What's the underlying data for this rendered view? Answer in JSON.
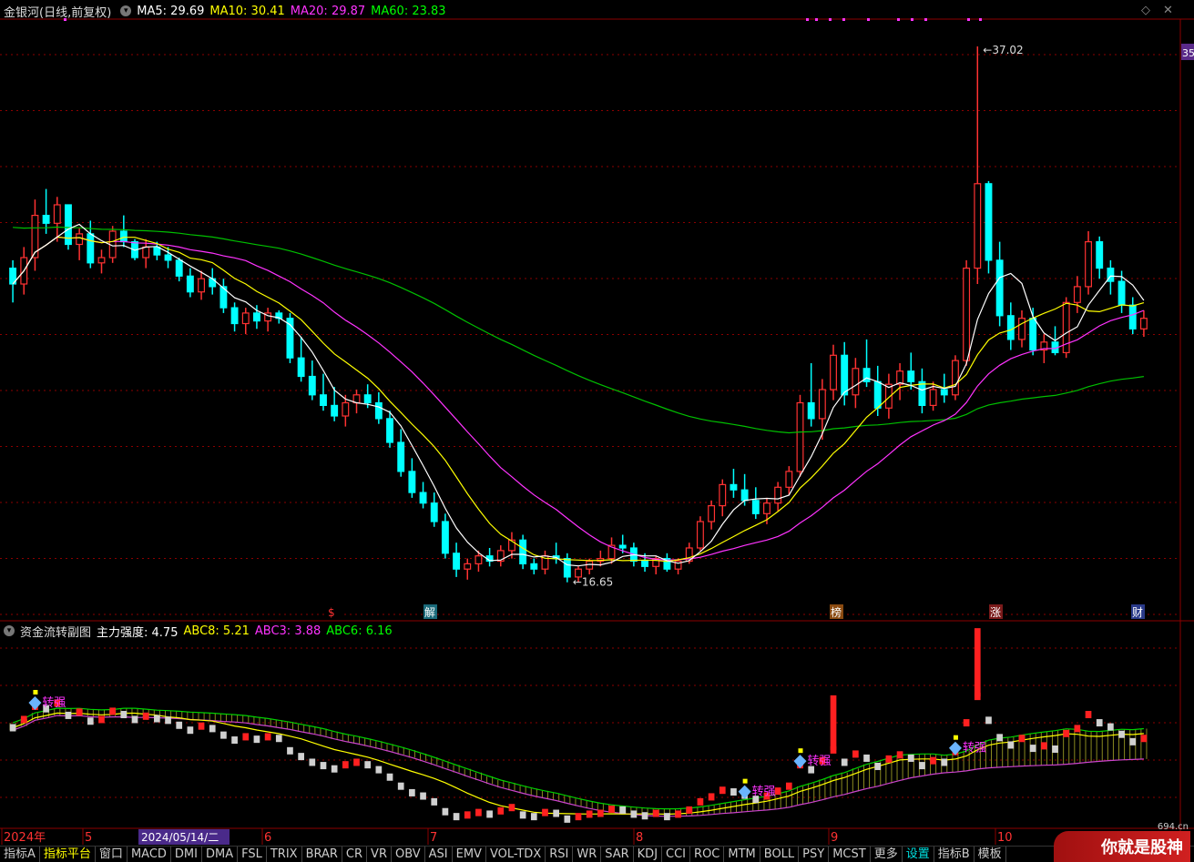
{
  "stock": {
    "title": "金银河(日线,前复权)"
  },
  "ma_legend": [
    {
      "label": "MA5: 29.69",
      "color": "#ffffff"
    },
    {
      "label": "MA10: 30.41",
      "color": "#ffff00"
    },
    {
      "label": "MA20: 29.87",
      "color": "#ff33ff"
    },
    {
      "label": "MA60: 23.83",
      "color": "#00ff00"
    }
  ],
  "sub_legend": {
    "title": "资金流转副图",
    "items": [
      {
        "label": "主力强度: 4.75",
        "color": "#ffffff"
      },
      {
        "label": "ABC8: 5.21",
        "color": "#ffff00"
      },
      {
        "label": "ABC3: 3.88",
        "color": "#ff33ff"
      },
      {
        "label": "ABC6: 6.16",
        "color": "#00ff00"
      }
    ]
  },
  "price_marks": {
    "high": "37.02",
    "low": "16.65"
  },
  "price_tag": "35",
  "event_markers": [
    "$",
    "解",
    "榜",
    "涨",
    "财"
  ],
  "signal_labels": [
    "转强",
    "转强",
    "转强",
    "转强"
  ],
  "date_axis": {
    "labels": [
      "2024年",
      "5",
      "6",
      "7",
      "8",
      "9",
      "10"
    ],
    "cursor_date": "2024/05/14/二"
  },
  "tabs": [
    "指标A",
    "指标平台",
    "窗口",
    "MACD",
    "DMI",
    "DMA",
    "FSL",
    "TRIX",
    "BRAR",
    "CR",
    "VR",
    "OBV",
    "ASI",
    "EMV",
    "VOL-TDX",
    "RSI",
    "WR",
    "SAR",
    "KDJ",
    "CCI",
    "ROC",
    "MTM",
    "BOLL",
    "PSY",
    "MCST",
    "更多",
    "设置",
    "指标B",
    "模板"
  ],
  "watermark": {
    "text": "你就是股神",
    "site": "694.cn"
  },
  "colors": {
    "up": "#ff3232",
    "down": "#00ffff",
    "ma5": "#ffffff",
    "ma10": "#ffff00",
    "ma20": "#ff33ff",
    "ma60": "#00c000",
    "grid": "#8b0000"
  },
  "chart_data": {
    "type": "candlestick",
    "price_axis": {
      "range": [
        16,
        38
      ]
    },
    "candles": [
      [
        28.6,
        28.9,
        27.3,
        28.0
      ],
      [
        28.0,
        29.4,
        27.6,
        29.0
      ],
      [
        29.0,
        31.2,
        28.5,
        30.6
      ],
      [
        30.6,
        31.6,
        29.9,
        30.3
      ],
      [
        30.3,
        31.3,
        29.6,
        31.0
      ],
      [
        31.0,
        31.0,
        29.3,
        29.5
      ],
      [
        29.5,
        30.1,
        28.9,
        29.9
      ],
      [
        29.9,
        30.4,
        28.6,
        28.8
      ],
      [
        28.8,
        29.3,
        28.4,
        29.0
      ],
      [
        29.0,
        30.2,
        28.8,
        30.0
      ],
      [
        30.0,
        30.6,
        29.4,
        29.6
      ],
      [
        29.6,
        29.7,
        28.9,
        29.0
      ],
      [
        29.0,
        29.7,
        28.6,
        29.4
      ],
      [
        29.4,
        29.6,
        28.9,
        29.1
      ],
      [
        29.1,
        29.4,
        28.6,
        28.9
      ],
      [
        28.9,
        29.0,
        28.1,
        28.3
      ],
      [
        28.3,
        28.6,
        27.5,
        27.7
      ],
      [
        27.7,
        28.5,
        27.4,
        28.2
      ],
      [
        28.2,
        28.6,
        27.6,
        27.9
      ],
      [
        27.9,
        28.2,
        26.9,
        27.1
      ],
      [
        27.1,
        27.3,
        26.2,
        26.5
      ],
      [
        26.5,
        27.1,
        26.1,
        26.9
      ],
      [
        26.9,
        27.2,
        26.3,
        26.6
      ],
      [
        26.6,
        27.1,
        26.2,
        26.9
      ],
      [
        26.9,
        27.0,
        26.5,
        26.7
      ],
      [
        26.7,
        26.9,
        25.0,
        25.2
      ],
      [
        25.2,
        26.0,
        24.3,
        24.5
      ],
      [
        24.5,
        25.1,
        23.6,
        23.8
      ],
      [
        23.8,
        24.6,
        23.2,
        23.4
      ],
      [
        23.4,
        24.1,
        22.8,
        23.0
      ],
      [
        23.0,
        23.8,
        22.6,
        23.5
      ],
      [
        23.5,
        24.0,
        23.1,
        23.8
      ],
      [
        23.8,
        24.2,
        23.3,
        23.5
      ],
      [
        23.5,
        23.9,
        22.7,
        22.9
      ],
      [
        22.9,
        23.2,
        21.8,
        22.0
      ],
      [
        22.0,
        22.5,
        20.7,
        20.9
      ],
      [
        20.9,
        21.4,
        19.9,
        20.1
      ],
      [
        20.1,
        20.5,
        19.5,
        19.7
      ],
      [
        19.7,
        20.1,
        18.8,
        19.0
      ],
      [
        19.0,
        19.3,
        17.6,
        17.8
      ],
      [
        17.8,
        18.2,
        16.9,
        17.2
      ],
      [
        17.2,
        17.6,
        16.8,
        17.4
      ],
      [
        17.4,
        17.9,
        17.1,
        17.7
      ],
      [
        17.7,
        18.0,
        17.3,
        17.5
      ],
      [
        17.5,
        18.1,
        17.3,
        17.9
      ],
      [
        17.9,
        18.6,
        17.6,
        18.3
      ],
      [
        18.3,
        18.5,
        17.2,
        17.4
      ],
      [
        17.4,
        17.6,
        17.0,
        17.2
      ],
      [
        17.2,
        17.9,
        17.0,
        17.7
      ],
      [
        17.7,
        18.2,
        17.4,
        17.6
      ],
      [
        17.6,
        17.8,
        16.7,
        16.9
      ],
      [
        16.9,
        17.3,
        16.7,
        17.2
      ],
      [
        17.2,
        17.6,
        17.0,
        17.5
      ],
      [
        17.5,
        17.9,
        17.3,
        17.6
      ],
      [
        17.6,
        18.4,
        17.4,
        18.1
      ],
      [
        18.1,
        18.5,
        17.8,
        18.0
      ],
      [
        18.0,
        18.2,
        17.3,
        17.5
      ],
      [
        17.5,
        17.8,
        17.1,
        17.3
      ],
      [
        17.3,
        17.7,
        17.0,
        17.6
      ],
      [
        17.6,
        17.8,
        17.1,
        17.2
      ],
      [
        17.2,
        17.6,
        17.0,
        17.5
      ],
      [
        17.5,
        18.2,
        17.4,
        18.0
      ],
      [
        18.0,
        19.2,
        17.9,
        19.0
      ],
      [
        19.0,
        19.8,
        18.7,
        19.6
      ],
      [
        19.6,
        20.6,
        19.2,
        20.4
      ],
      [
        20.4,
        21.0,
        19.9,
        20.2
      ],
      [
        20.2,
        20.8,
        19.6,
        19.8
      ],
      [
        19.8,
        20.3,
        19.1,
        19.3
      ],
      [
        19.3,
        19.9,
        18.9,
        19.7
      ],
      [
        19.7,
        20.5,
        19.4,
        20.3
      ],
      [
        20.3,
        21.1,
        20.0,
        20.9
      ],
      [
        20.9,
        23.8,
        20.7,
        23.5
      ],
      [
        23.5,
        25.0,
        22.6,
        22.9
      ],
      [
        22.9,
        24.4,
        22.1,
        24.0
      ],
      [
        24.0,
        25.7,
        23.6,
        25.3
      ],
      [
        25.3,
        25.8,
        23.4,
        23.8
      ],
      [
        23.8,
        25.2,
        23.3,
        24.8
      ],
      [
        24.8,
        25.9,
        24.1,
        24.3
      ],
      [
        24.3,
        24.9,
        23.0,
        23.3
      ],
      [
        23.3,
        24.6,
        22.9,
        24.2
      ],
      [
        24.2,
        25.0,
        23.6,
        24.7
      ],
      [
        24.7,
        25.4,
        24.0,
        24.3
      ],
      [
        24.3,
        24.8,
        23.1,
        23.4
      ],
      [
        23.4,
        24.3,
        23.2,
        24.0
      ],
      [
        24.0,
        24.6,
        23.5,
        23.8
      ],
      [
        23.8,
        25.3,
        23.6,
        25.1
      ],
      [
        25.1,
        28.9,
        24.9,
        28.6
      ],
      [
        28.6,
        37.0,
        28.0,
        31.8
      ],
      [
        31.8,
        31.9,
        28.4,
        28.9
      ],
      [
        28.9,
        29.6,
        26.4,
        26.8
      ],
      [
        26.8,
        27.3,
        25.5,
        25.9
      ],
      [
        25.9,
        27.0,
        25.6,
        26.7
      ],
      [
        26.7,
        27.1,
        25.3,
        25.5
      ],
      [
        25.5,
        26.1,
        25.0,
        25.8
      ],
      [
        25.8,
        26.4,
        25.3,
        25.4
      ],
      [
        25.4,
        27.5,
        25.2,
        27.3
      ],
      [
        27.3,
        28.3,
        26.9,
        27.9
      ],
      [
        27.9,
        30.0,
        27.6,
        29.6
      ],
      [
        29.6,
        29.8,
        28.2,
        28.6
      ],
      [
        28.6,
        28.9,
        27.6,
        28.1
      ],
      [
        28.1,
        28.5,
        26.9,
        27.2
      ],
      [
        27.2,
        27.5,
        26.1,
        26.3
      ],
      [
        26.3,
        27.0,
        26.0,
        26.7
      ]
    ]
  }
}
